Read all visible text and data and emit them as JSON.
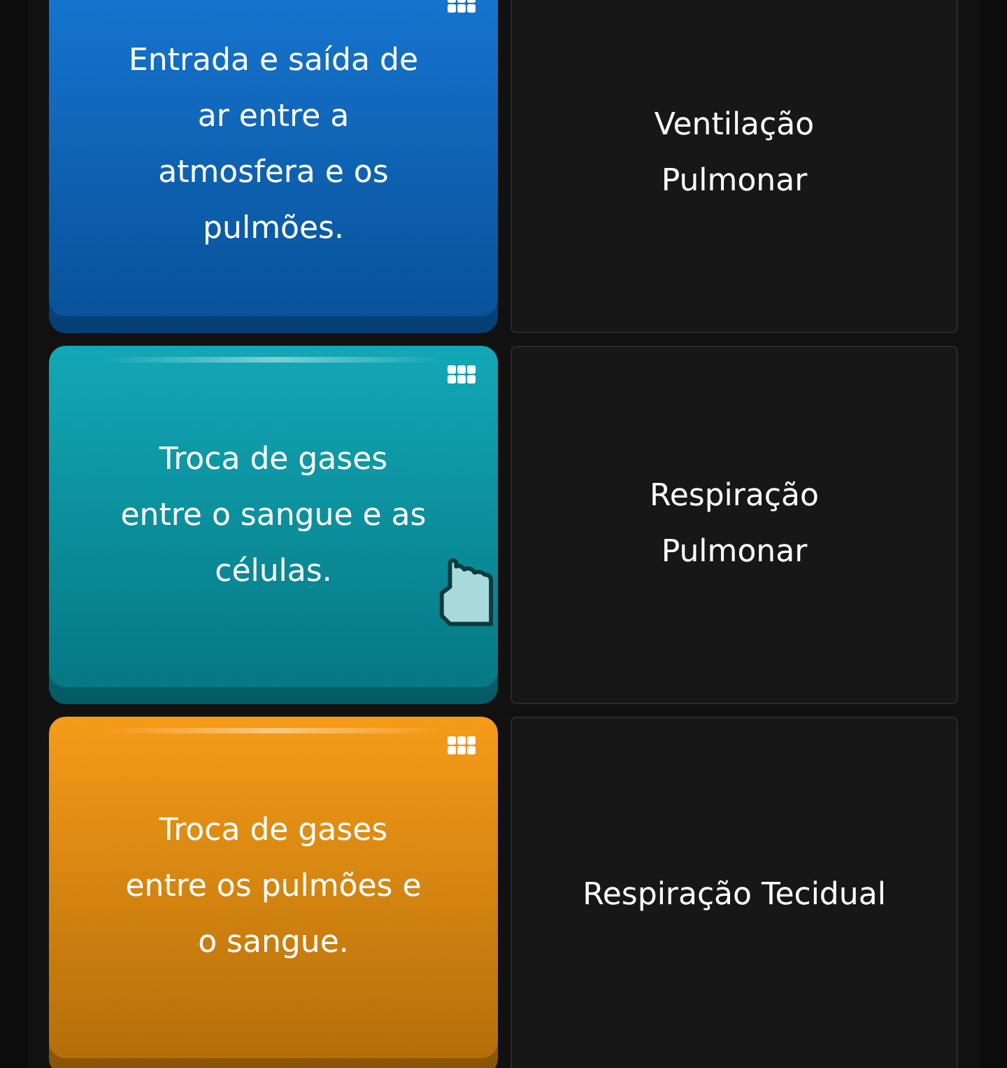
{
  "rows": [
    {
      "prompt": [
        "Entrada e saída de",
        "ar entre a",
        "atmosfera e os",
        "pulmões."
      ],
      "color": "#0a6fd0",
      "pointer_over": false,
      "answer": [
        "Ventilação",
        "Pulmonar"
      ]
    },
    {
      "prompt": [
        "Troca de gases",
        "entre o sangue e as",
        "células."
      ],
      "color": "#06a3b3",
      "pointer_over": true,
      "answer": [
        "Respiração",
        "Pulmonar"
      ]
    },
    {
      "prompt": [
        "Troca de gases",
        "entre os pulmões e",
        "o sangue."
      ],
      "color": "#f5960c",
      "pointer_over": false,
      "answer": [
        "Respiração Tecidual"
      ]
    }
  ]
}
